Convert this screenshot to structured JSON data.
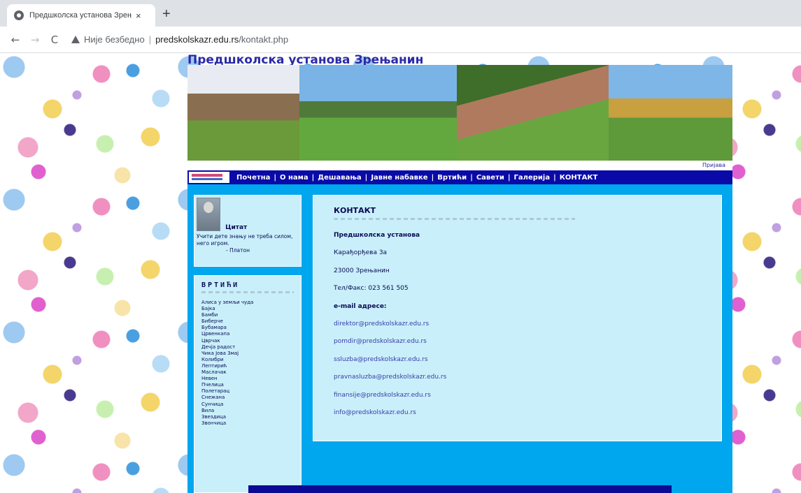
{
  "browser": {
    "tab_title": "Предшколска установа Зрењан",
    "tab_close": "×",
    "new_tab": "+",
    "back": "←",
    "forward": "→",
    "reload": "C",
    "security_text": "Није безбедно",
    "url_separator": "|",
    "url_host": "predskolskazr.edu.rs",
    "url_path": "/kontakt.php"
  },
  "site": {
    "title": "Предшколска установа Зрењанин",
    "login": "Пријава",
    "nav": [
      "Почетна",
      "О нама",
      "Дешавања",
      "Јавне набавке",
      "Вртићи",
      "Савети",
      "Галерија",
      "КОНТАКТ"
    ],
    "nav_separator": "|"
  },
  "quote": {
    "title": "Цитат",
    "text": "Учити дете знању не треба силом, него игром.",
    "author": "- Платон"
  },
  "kindergartens": {
    "title": "ВРТИЋИ",
    "items": [
      "Алиса у земљи чуда",
      "Бајка",
      "Бамби",
      "Биберче",
      "Бубамара",
      "Црвенкапа",
      "Цврчак",
      "Дечја радост",
      "Чика Јова Змај",
      "Колибри",
      "Лептирић",
      "Маслачак",
      "Невен",
      "Пчелица",
      "Полетарац",
      "Снежана",
      "Сунчица",
      "Вила",
      "Звездица",
      "Звончица"
    ]
  },
  "contact": {
    "title": "КОНТАКТ",
    "org": "Предшколска установа",
    "address": "Карађорђева 3а",
    "city": "23000 Зрењанин",
    "phone": "Тел/Факс: 023 561 505",
    "email_heading": "e-mail адресе:",
    "emails": [
      "direktor@predskolskazr.edu.rs",
      "pomdir@predskolskazr.edu.rs",
      "ssluzba@predskolskazr.edu.rs",
      "pravnasluzba@predskolskazr.edu.rs",
      "finansije@predskolskazr.edu.rs",
      "info@predskolskazr.edu.rs"
    ]
  },
  "colors": {
    "nav_bg": "#0a0aa8",
    "content_bg": "#00a6ee",
    "box_bg": "#c9f0fa",
    "title_color": "#2a2aa8"
  }
}
